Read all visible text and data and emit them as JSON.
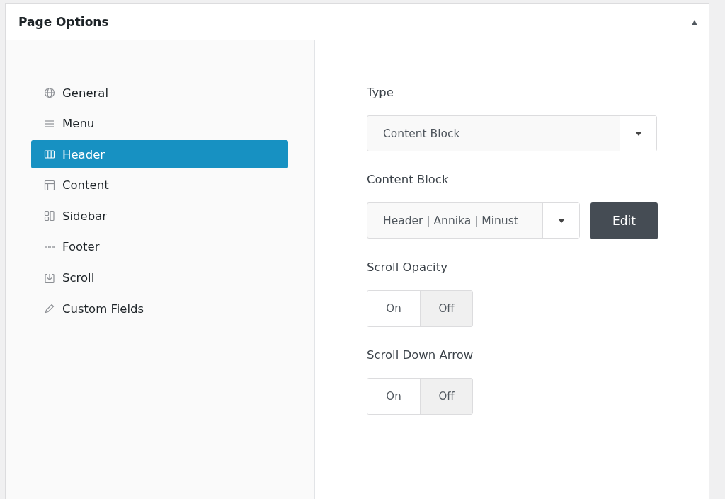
{
  "panel": {
    "title": "Page Options",
    "collapse_icon": "▲"
  },
  "sidebar": {
    "items": [
      {
        "label": "General",
        "selected": false
      },
      {
        "label": "Menu",
        "selected": false
      },
      {
        "label": "Header",
        "selected": true
      },
      {
        "label": "Content",
        "selected": false
      },
      {
        "label": "Sidebar",
        "selected": false
      },
      {
        "label": "Footer",
        "selected": false
      },
      {
        "label": "Scroll",
        "selected": false
      },
      {
        "label": "Custom Fields",
        "selected": false
      }
    ]
  },
  "fields": [
    {
      "kind": "select",
      "label": "Type",
      "value": "Content Block"
    },
    {
      "kind": "select_with_button",
      "label": "Content Block",
      "value": "Header | Annika | Minust",
      "button": "Edit"
    },
    {
      "kind": "toggle",
      "label": "Scroll Opacity",
      "options": [
        {
          "label": "On",
          "selected": false
        },
        {
          "label": "Off",
          "selected": true
        }
      ]
    },
    {
      "kind": "toggle",
      "label": "Scroll Down Arrow",
      "options": [
        {
          "label": "On",
          "selected": false
        },
        {
          "label": "Off",
          "selected": true
        }
      ]
    }
  ]
}
